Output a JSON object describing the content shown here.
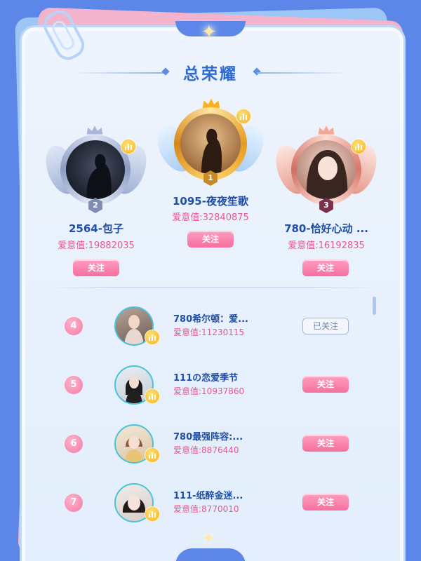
{
  "title": "总荣耀",
  "podium": [
    {
      "rank": "2",
      "name": "2564-包子",
      "score_label": "爱意值:",
      "score": "19882035",
      "button": "关注"
    },
    {
      "rank": "1",
      "name": "1095-夜夜笙歌",
      "score_label": "爱意值:",
      "score": "32840875",
      "button": "关注"
    },
    {
      "rank": "3",
      "name": "780-恰好心动 ...",
      "score_label": "爱意值:",
      "score": "16192835",
      "button": "关注"
    }
  ],
  "list": [
    {
      "rank": "4",
      "name": "780希尔顿：爱...",
      "score_label": "爱意值:",
      "score": "11230115",
      "button": "已关注",
      "followed": true
    },
    {
      "rank": "5",
      "name": "111の恋爱季节",
      "score_label": "爱意值:",
      "score": "10937860",
      "button": "关注",
      "followed": false
    },
    {
      "rank": "6",
      "name": "780最强阵容:...",
      "score_label": "爱意值:",
      "score": "8876440",
      "button": "关注",
      "followed": false
    },
    {
      "rank": "7",
      "name": "111-纸醉金迷...",
      "score_label": "爱意值:",
      "score": "8770010",
      "button": "关注",
      "followed": false
    }
  ],
  "colors": {
    "background": "#5c86e8",
    "accent_blue": "#2f6bd6",
    "score_pink": "#e6588e",
    "button_pink": "#f56f9f",
    "gold": "#f3b324",
    "silver": "#8f9fc6",
    "bronze": "#e59a8c"
  },
  "icons": {
    "crown": "crown-icon",
    "stats_badge": "bar-chart-badge-icon",
    "paperclip": "paperclip-icon",
    "sparkle": "sparkle-star-icon"
  }
}
